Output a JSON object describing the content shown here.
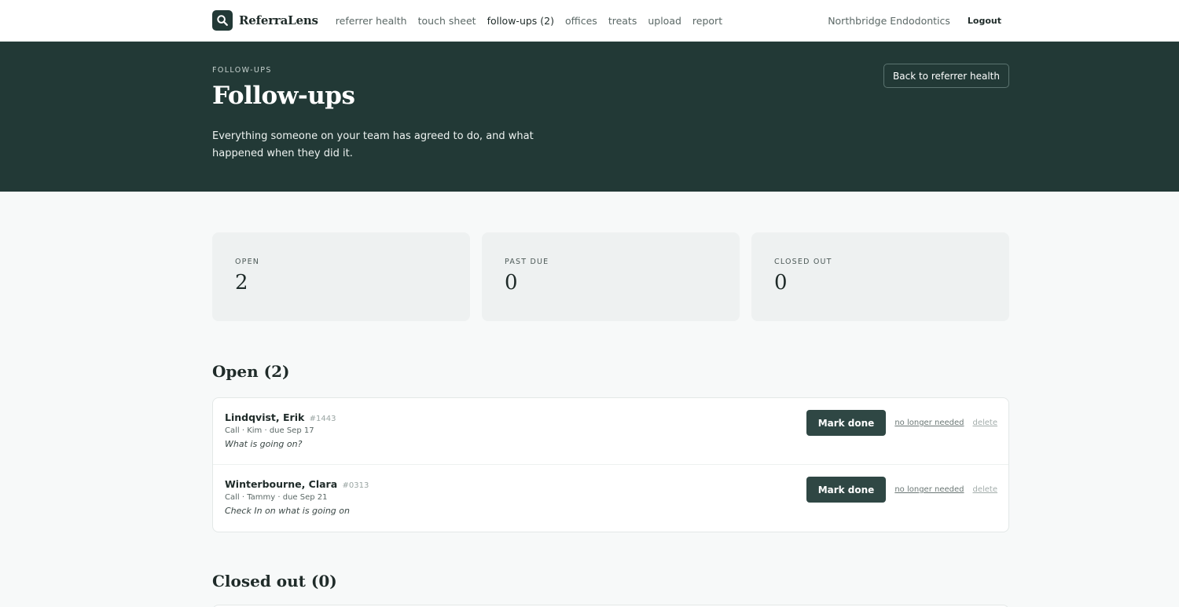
{
  "app": {
    "name": "ReferraLens",
    "practice": "Northbridge Endodontics",
    "logout_label": "Logout",
    "nav": [
      {
        "label": "referrer health"
      },
      {
        "label": "touch sheet"
      },
      {
        "label": "follow-ups (2)",
        "active": true
      },
      {
        "label": "offices"
      },
      {
        "label": "treats"
      },
      {
        "label": "upload"
      },
      {
        "label": "report"
      }
    ]
  },
  "hero": {
    "eyebrow": "FOLLOW-UPS",
    "title": "Follow-ups",
    "description": "Everything someone on your team has agreed to do, and what happened when they did it.",
    "back_label": "Back to referrer health"
  },
  "stats": [
    {
      "label": "OPEN",
      "value": "2"
    },
    {
      "label": "PAST DUE",
      "value": "0"
    },
    {
      "label": "CLOSED OUT",
      "value": "0"
    }
  ],
  "open": {
    "title": "Open (2)",
    "items": [
      {
        "name": "Lindqvist, Erik",
        "id": "#1443",
        "meta": "Call · Kim · due Sep 17",
        "note": "What is going on?",
        "done_label": "Mark done",
        "not_needed_label": "no longer needed",
        "delete_label": "delete"
      },
      {
        "name": "Winterbourne, Clara",
        "id": "#0313",
        "meta": "Call · Tammy · due Sep 21",
        "note": "Check In on what is going on",
        "done_label": "Mark done",
        "not_needed_label": "no longer needed",
        "delete_label": "delete"
      }
    ]
  },
  "closed": {
    "title": "Closed out (0)"
  },
  "colors": {
    "brand_dark": "#223936",
    "button": "#2f4744",
    "page_bg": "#f7f9f9",
    "stat_bg": "#eef1f1"
  },
  "icons": {
    "logo": "magnifier-icon"
  }
}
